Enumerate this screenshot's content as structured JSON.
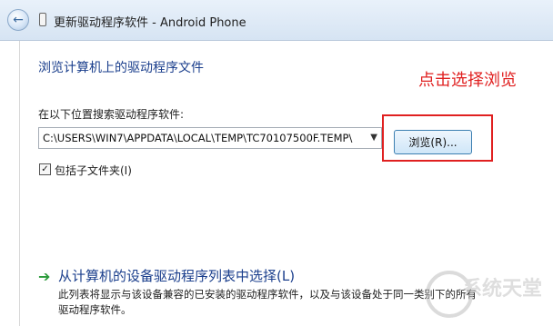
{
  "window": {
    "title": "更新驱动程序软件 - Android Phone",
    "back_icon": "back-arrow-icon",
    "device_icon": "phone-device-icon"
  },
  "main": {
    "heading": "浏览计算机上的驱动程序文件",
    "search_label": "在以下位置搜索驱动程序软件:",
    "path_value": "C:\\USERS\\WIN7\\APPDATA\\LOCAL\\TEMP\\TC70107500F.TEMP\\",
    "browse_button": "浏览(R)...",
    "include_subfolders_label": "包括子文件夹(I)",
    "include_subfolders_checked": true,
    "annotation": "点击选择浏览",
    "annotation_color": "#e02020"
  },
  "option": {
    "title": "从计算机的设备驱动程序列表中选择(L)",
    "description": "此列表将显示与该设备兼容的已安装的驱动程序软件，以及与该设备处于同一类别下的所有驱动程序软件。",
    "icon": "green-arrow-icon"
  },
  "watermark": {
    "text": "系统天堂"
  }
}
